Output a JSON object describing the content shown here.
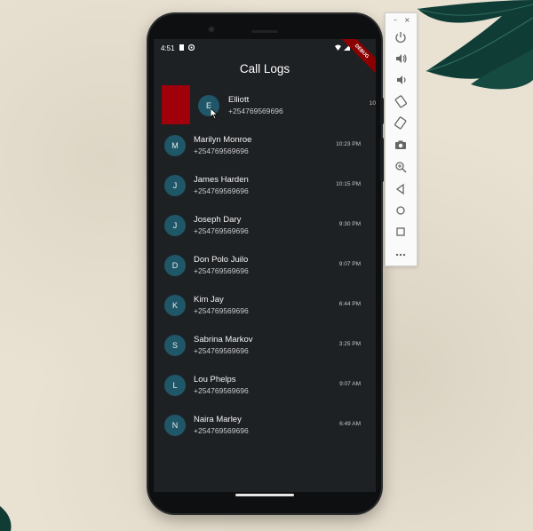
{
  "app": {
    "title": "Call Logs"
  },
  "status_bar": {
    "time": "4:51",
    "debug_banner": "DEBUG"
  },
  "swiped_call": {
    "initial": "E",
    "name": "Elliott",
    "number": "+254769569696",
    "time_fragment": "10"
  },
  "calls": [
    {
      "initial": "M",
      "name": "Marilyn Monroe",
      "number": "+254769569696",
      "time": "10:23 PM"
    },
    {
      "initial": "J",
      "name": "James Harden",
      "number": "+254769569696",
      "time": "10:15 PM"
    },
    {
      "initial": "J",
      "name": "Joseph Dary",
      "number": "+254769569696",
      "time": "9:30 PM"
    },
    {
      "initial": "D",
      "name": "Don Polo Juilo",
      "number": "+254769569696",
      "time": "9:07 PM"
    },
    {
      "initial": "K",
      "name": "Kim Jay",
      "number": "+254769569696",
      "time": "6:44 PM"
    },
    {
      "initial": "S",
      "name": "Sabrina Markov",
      "number": "+254769569696",
      "time": "3:25 PM"
    },
    {
      "initial": "L",
      "name": "Lou Phelps",
      "number": "+254769569696",
      "time": "9:07 AM"
    },
    {
      "initial": "N",
      "name": "Naira Marley",
      "number": "+254769569696",
      "time": "6:49 AM"
    }
  ],
  "emulator_toolbar": {
    "window_controls": [
      "minimize-icon",
      "close-icon"
    ],
    "buttons": [
      "power-icon",
      "volume-up-icon",
      "volume-down-icon",
      "rotate-left-icon",
      "rotate-right-icon",
      "camera-icon",
      "zoom-icon",
      "back-icon",
      "home-icon",
      "overview-icon",
      "more-icon"
    ]
  },
  "colors": {
    "screen_bg": "#1e2124",
    "avatar_bg": "#1f5768",
    "delete_bg": "#a0000a",
    "debug_banner": "#8b0000"
  }
}
